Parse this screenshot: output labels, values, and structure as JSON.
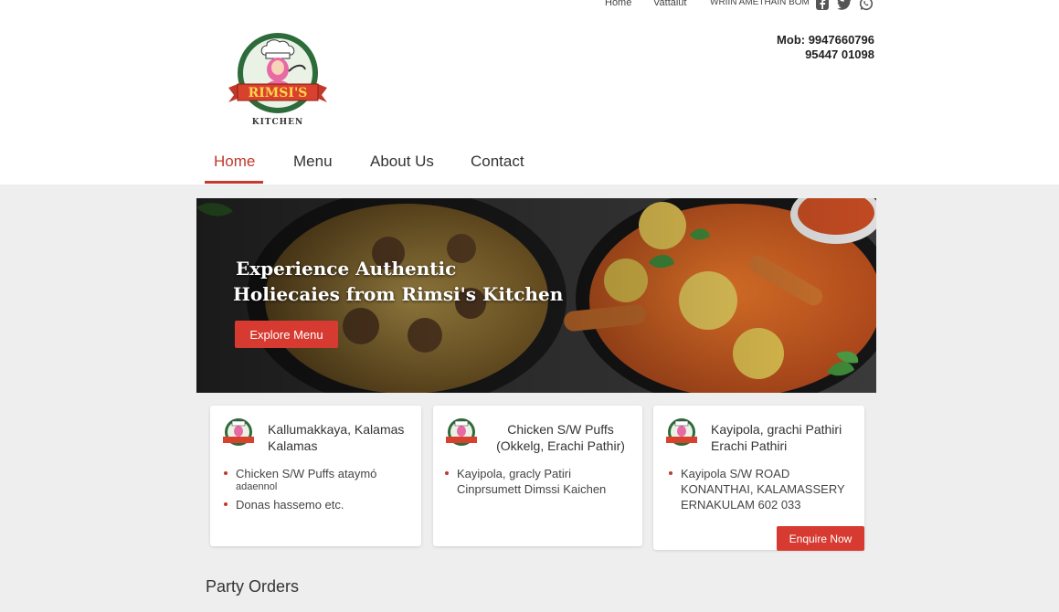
{
  "top_links": [
    "Home",
    "Vattaiut",
    "WRIIN AMETHAIN BOM"
  ],
  "social_icons": [
    "facebook-icon",
    "twitter-icon",
    "whatsapp-icon"
  ],
  "contact": {
    "mob_label": "Mob: 9947660796",
    "mob2": "95447 01098"
  },
  "logo": {
    "text": "RIMSI'S",
    "subtext": "KITCHEN"
  },
  "nav": {
    "items": [
      "Home",
      "Menu",
      "About Us",
      "Contact"
    ],
    "active": "Home"
  },
  "hero": {
    "line1": "Experience Authentic",
    "line2": "Holiecaies from Rimsi's Kitchen",
    "button": "Explore Menu"
  },
  "cards": [
    {
      "title_line1": "Kallumakkaya, Kalamas",
      "title_line2": "Kalamas",
      "bullets": [
        {
          "text": "Chicken S/W Puffs ataymó",
          "sub": "adaennol"
        },
        {
          "text": "Donas hassemo etc.",
          "sub": ""
        }
      ]
    },
    {
      "title_line1": "Chicken S/W Puffs",
      "title_line2": "(Okkelg, Erachi Pathir)",
      "bullets": [
        {
          "text": "Kayipola, gracly Patiri",
          "sub": "Cinprsumett Dimssi Kaichen"
        }
      ]
    },
    {
      "title_line1": "Kayipola, grachi Pathiri",
      "title_line2": "Erachi Pathiri",
      "bullets": [
        {
          "text": "Kayipola S/W ROAD",
          "sub": "KONANTHAI, KALAMASSERY",
          "sub2": "ERNAKULAM 602 033"
        }
      ],
      "button": "Enquire Now"
    }
  ],
  "section_title": "Party Orders",
  "colors": {
    "accent": "#d63a30",
    "active_nav": "#c0392b",
    "page_bg": "#eeeeee"
  }
}
